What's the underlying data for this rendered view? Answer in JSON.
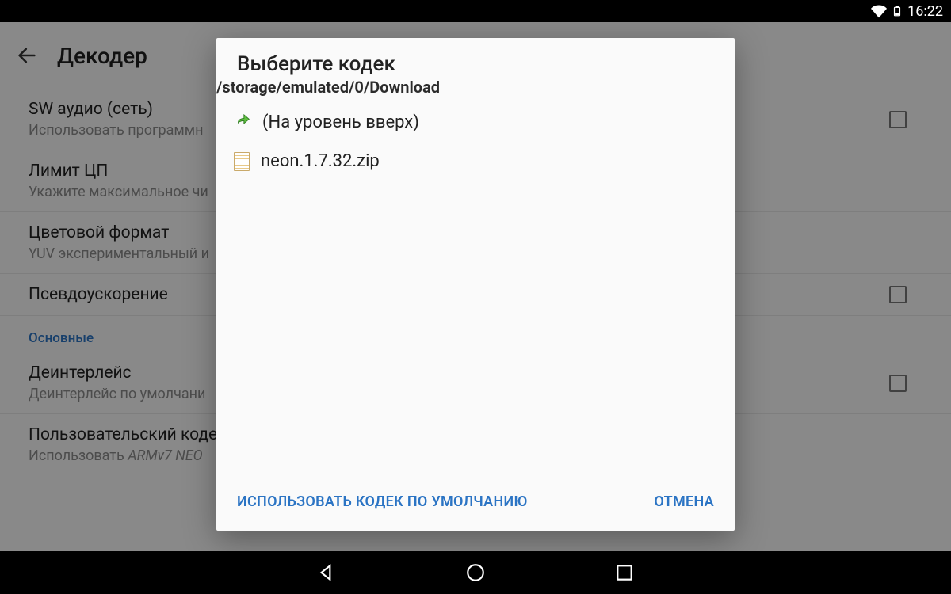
{
  "statusbar": {
    "time": "16:22"
  },
  "toolbar": {
    "title": "Декодер"
  },
  "settings": {
    "items": [
      {
        "primary": "SW аудио (сеть)",
        "secondary": "Использовать программн",
        "checkbox": true
      },
      {
        "primary": "Лимит ЦП",
        "secondary": "Укажите максимальное чи",
        "checkbox": false
      },
      {
        "primary": "Цветовой формат",
        "secondary": "YUV экспериментальный и",
        "checkbox": false
      },
      {
        "primary": "Псевдоускорение",
        "secondary": "",
        "checkbox": true
      }
    ],
    "section_label": "Основные",
    "items2": [
      {
        "primary": "Деинтерлейс",
        "secondary": "Деинтерлейс по умолчани",
        "checkbox": true
      },
      {
        "primary": "Пользовательский коде",
        "secondary_prefix": "Использовать ",
        "secondary_italic": "ARMv7 NEO",
        "checkbox": false
      }
    ]
  },
  "dialog": {
    "title": "Выберите кодек",
    "path": "/storage/emulated/0/Download",
    "up_label": "(На уровень вверх)",
    "files": [
      {
        "name": "neon.1.7.32.zip"
      }
    ],
    "action_default": "Использовать кодек по умолчанию",
    "action_cancel": "Отмена"
  }
}
